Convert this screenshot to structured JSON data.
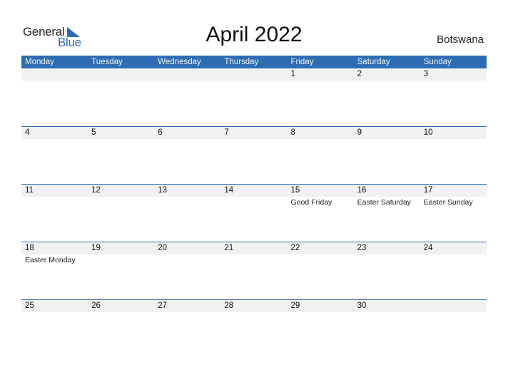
{
  "logo": {
    "text_general": "General",
    "text_blue": "Blue",
    "icon": "triangle-flag-icon"
  },
  "title": "April 2022",
  "country": "Botswana",
  "colors": {
    "accent": "#2e6db4",
    "band": "#f1f1f1"
  },
  "weekdays": [
    "Monday",
    "Tuesday",
    "Wednesday",
    "Thursday",
    "Friday",
    "Saturday",
    "Sunday"
  ],
  "weeks": [
    [
      {
        "day": "",
        "holiday": ""
      },
      {
        "day": "",
        "holiday": ""
      },
      {
        "day": "",
        "holiday": ""
      },
      {
        "day": "",
        "holiday": ""
      },
      {
        "day": "1",
        "holiday": ""
      },
      {
        "day": "2",
        "holiday": ""
      },
      {
        "day": "3",
        "holiday": ""
      }
    ],
    [
      {
        "day": "4",
        "holiday": ""
      },
      {
        "day": "5",
        "holiday": ""
      },
      {
        "day": "6",
        "holiday": ""
      },
      {
        "day": "7",
        "holiday": ""
      },
      {
        "day": "8",
        "holiday": ""
      },
      {
        "day": "9",
        "holiday": ""
      },
      {
        "day": "10",
        "holiday": ""
      }
    ],
    [
      {
        "day": "11",
        "holiday": ""
      },
      {
        "day": "12",
        "holiday": ""
      },
      {
        "day": "13",
        "holiday": ""
      },
      {
        "day": "14",
        "holiday": ""
      },
      {
        "day": "15",
        "holiday": "Good Friday"
      },
      {
        "day": "16",
        "holiday": "Easter Saturday"
      },
      {
        "day": "17",
        "holiday": "Easter Sunday"
      }
    ],
    [
      {
        "day": "18",
        "holiday": "Easter Monday"
      },
      {
        "day": "19",
        "holiday": ""
      },
      {
        "day": "20",
        "holiday": ""
      },
      {
        "day": "21",
        "holiday": ""
      },
      {
        "day": "22",
        "holiday": ""
      },
      {
        "day": "23",
        "holiday": ""
      },
      {
        "day": "24",
        "holiday": ""
      }
    ],
    [
      {
        "day": "25",
        "holiday": ""
      },
      {
        "day": "26",
        "holiday": ""
      },
      {
        "day": "27",
        "holiday": ""
      },
      {
        "day": "28",
        "holiday": ""
      },
      {
        "day": "29",
        "holiday": ""
      },
      {
        "day": "30",
        "holiday": ""
      },
      {
        "day": "",
        "holiday": ""
      }
    ]
  ]
}
